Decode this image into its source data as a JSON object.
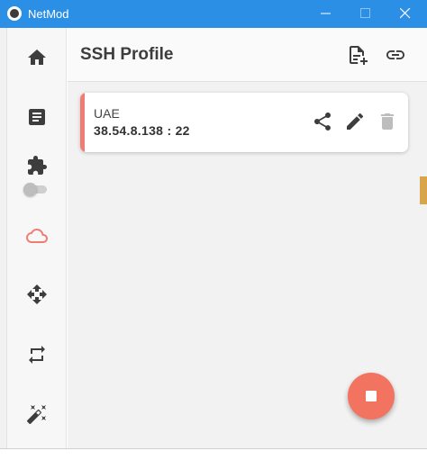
{
  "window": {
    "title": "NetMod"
  },
  "sidebar": {
    "items": [
      {
        "name": "home",
        "icon": "home-icon"
      },
      {
        "name": "logs",
        "icon": "article-icon"
      },
      {
        "name": "extensions",
        "icon": "puzzle-icon"
      },
      {
        "name": "ssh-profile",
        "icon": "cloud-icon",
        "active": true
      },
      {
        "name": "move",
        "icon": "move-arrows-icon"
      },
      {
        "name": "repeat",
        "icon": "repeat-icon"
      },
      {
        "name": "tools",
        "icon": "magic-wand-icon"
      }
    ],
    "extensions_toggle_on": false
  },
  "header": {
    "title": "SSH Profile",
    "actions": [
      "add-file-icon",
      "link-icon"
    ]
  },
  "profiles": [
    {
      "name": "UAE",
      "address": "38.54.8.138 : 22",
      "actions": [
        "share-icon",
        "edit-icon",
        "delete-icon"
      ]
    }
  ],
  "fab": {
    "icon": "stop-icon"
  },
  "colors": {
    "titlebar": "#2b8fe6",
    "accent": "#f07d74",
    "fab": "#f2735f",
    "icon": "#3d3d3d"
  }
}
